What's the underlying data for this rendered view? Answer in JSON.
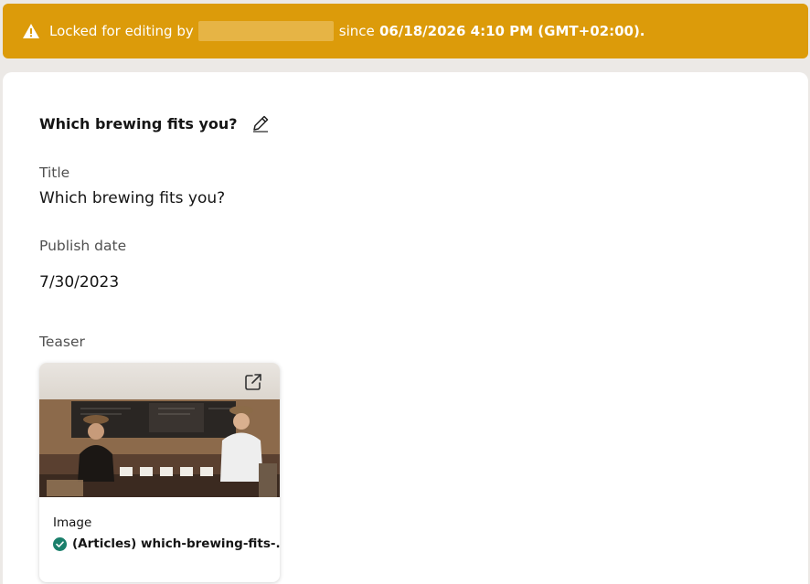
{
  "lock_banner": {
    "prefix": "Locked for editing by",
    "since_label": "since",
    "timestamp": "06/18/2026 4:10 PM (GMT+02:00).",
    "icon": "warning-icon",
    "color": "#dc9b0a"
  },
  "item": {
    "heading": "Which brewing fits you?",
    "edit_icon": "pencil-icon"
  },
  "fields": {
    "title_label": "Title",
    "title_value": "Which brewing fits you?",
    "publish_label": "Publish date",
    "publish_value": "7/30/2023",
    "teaser_label": "Teaser"
  },
  "teaser": {
    "type": "Image",
    "item_name": "(Articles) which-brewing-fits-...",
    "status_icon": "check-circle-icon",
    "status_color": "#1a7f6b",
    "open_icon": "external-link-icon"
  }
}
